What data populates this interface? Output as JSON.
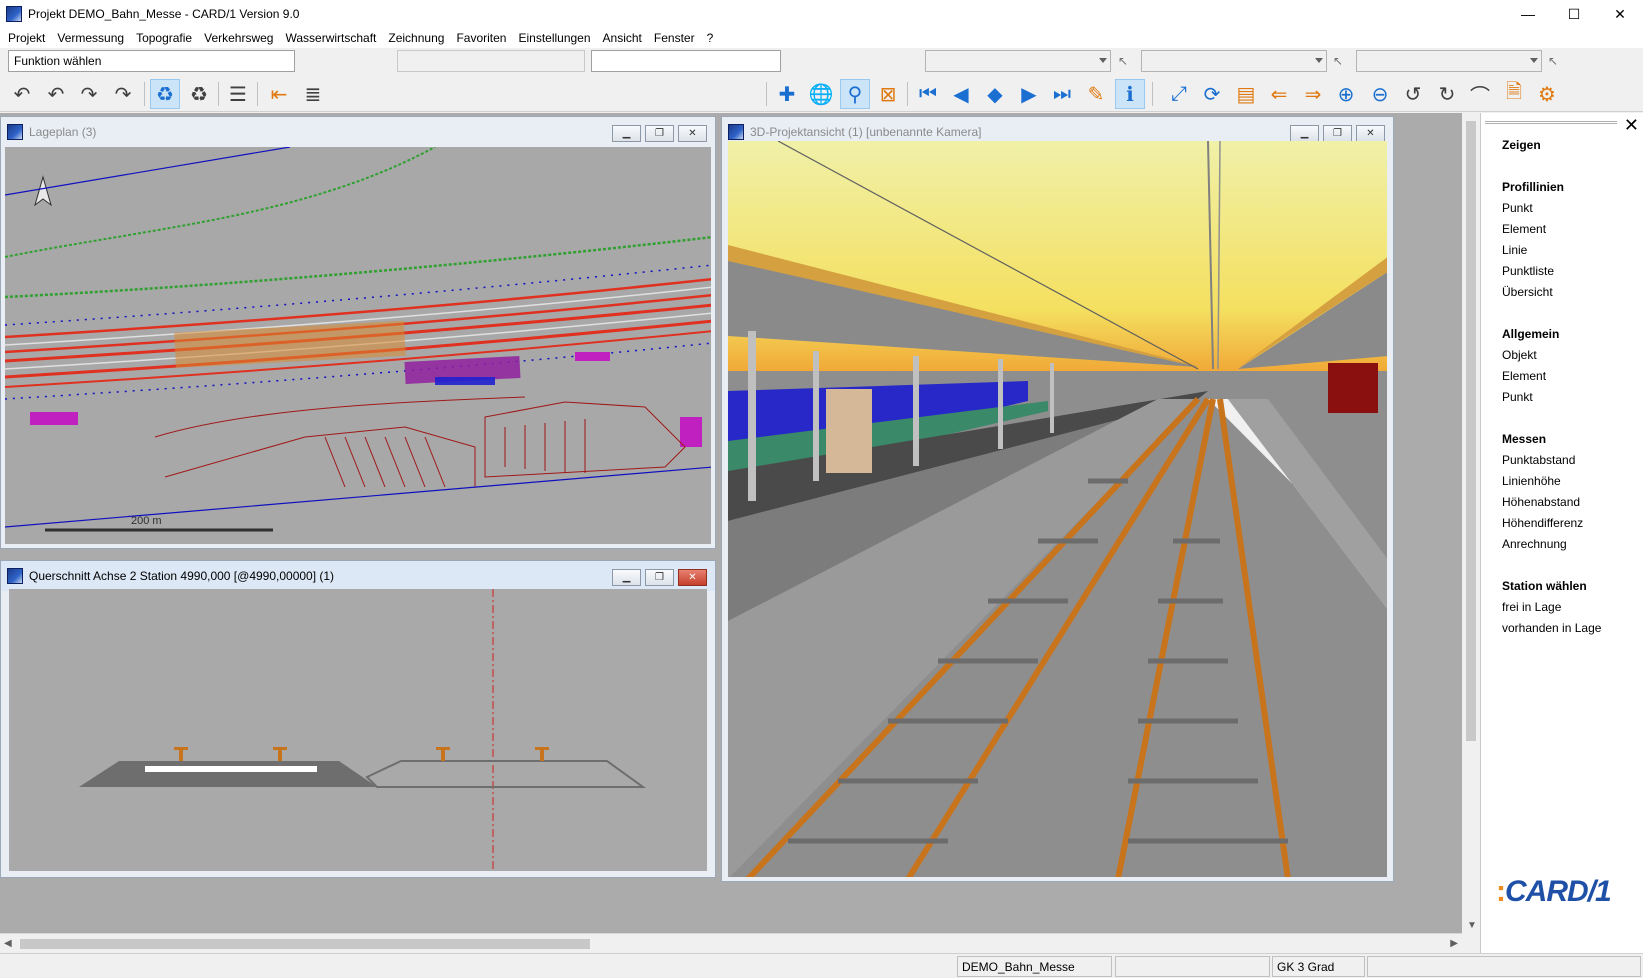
{
  "window": {
    "title": "Projekt DEMO_Bahn_Messe - CARD/1 Version 9.0",
    "minimize": "—",
    "maximize": "☐",
    "close": "✕"
  },
  "menu": [
    "Projekt",
    "Vermessung",
    "Topografie",
    "Verkehrsweg",
    "Wasserwirtschaft",
    "Zeichnung",
    "Favoriten",
    "Einstellungen",
    "Ansicht",
    "Fenster",
    "?"
  ],
  "function_field": "Funktion wählen",
  "toolbar_icons": [
    "undo-icon",
    "undo-all-icon",
    "redo-icon",
    "redo-all-icon",
    "recycle-icon",
    "recycle-gray-icon",
    "list-icon",
    "indent-icon",
    "lines-icon",
    "plus-icon",
    "globe-icon",
    "pin-icon",
    "delete-icon",
    "first-icon",
    "prev-icon",
    "updown-icon",
    "next-icon",
    "last-icon",
    "pencil-icon",
    "info-icon",
    "fit-icon",
    "refresh-icon",
    "window-icon",
    "import-icon",
    "export-icon",
    "zoom-in-icon",
    "zoom-out-icon",
    "rotate-left-icon",
    "rotate-right-icon",
    "redraw-icon",
    "document-icon",
    "settings-icon"
  ],
  "windows": {
    "lageplan": {
      "title": "Lageplan (3)",
      "scale_label": "200 m"
    },
    "querschnitt": {
      "title": "Querschnitt Achse 2 Station 4990,000 [@4990,00000] (1)"
    },
    "view3d": {
      "title": "3D-Projektansicht (1) [unbenannte Kamera]"
    }
  },
  "child_buttons": {
    "min": "▁",
    "restore": "❐",
    "close": "✕"
  },
  "right_panel": {
    "close": "✕",
    "sections": [
      {
        "header": "Zeigen",
        "items": []
      },
      {
        "header": "Profillinien",
        "items": [
          "Punkt",
          "Element",
          "Linie",
          "Punktliste",
          "Übersicht"
        ]
      },
      {
        "header": "Allgemein",
        "items": [
          "Objekt",
          "Element",
          "Punkt"
        ]
      },
      {
        "header": "Messen",
        "items": [
          "Punktabstand",
          "Linienhöhe",
          "Höhenabstand",
          "Höhendifferenz",
          "Anrechnung"
        ]
      },
      {
        "header": "Station wählen",
        "items": [
          "frei in Lage",
          "vorhanden in Lage"
        ]
      }
    ],
    "logo": "CARD/1"
  },
  "status": {
    "project": "DEMO_Bahn_Messe",
    "crs": "GK 3 Grad"
  },
  "colors": {
    "track_red": "#e03020",
    "green_line": "#30a030",
    "blue_line": "#1010c0",
    "magenta": "#b020c0",
    "rail_orange": "#c8741c"
  }
}
